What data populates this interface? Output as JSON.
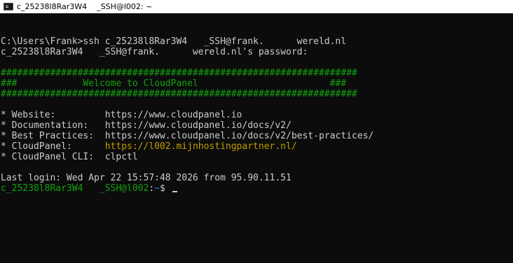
{
  "window": {
    "title": "c_25238l8Rar3W4    _SSH@l002: ~",
    "icon": "terminal-icon"
  },
  "terminal": {
    "lines": {
      "cmd": "C:\\Users\\Frank>ssh c_25238l8Rar3W4   _SSH@frank.      wereld.nl",
      "password": "c_25238l8Rar3W4   _SSH@frank.      wereld.nl's password:",
      "banner_top": "#################################################################",
      "banner_middle": "###            Welcome to CloudPanel                        ###",
      "banner_bottom": "#################################################################",
      "website_label": "* Website:         ",
      "website_value": "https://www.cloudpanel.io",
      "docs_label": "* Documentation:   ",
      "docs_value": "https://www.cloudpanel.io/docs/v2/",
      "best_label": "* Best Practices:  ",
      "best_value": "https://www.cloudpanel.io/docs/v2/best-practices/",
      "cp_label": "* CloudPanel:      ",
      "cp_value": "https://l002.mijnhostingpartner.nl/",
      "cli_label": "* CloudPanel CLI:  ",
      "cli_value": "clpctl",
      "last_login": "Last login: Wed Apr 22 15:57:48 2026 from 95.90.11.51",
      "prompt_user": "c_25238l8Rar3W4   _SSH@l002",
      "prompt_colon": ":",
      "prompt_path": "~",
      "prompt_symbol": "$ "
    }
  },
  "colors": {
    "background": "#0c0c0c",
    "text": "#cccccc",
    "green": "#13a10e",
    "yellow": "#c19c00",
    "blue": "#3b78ff"
  }
}
